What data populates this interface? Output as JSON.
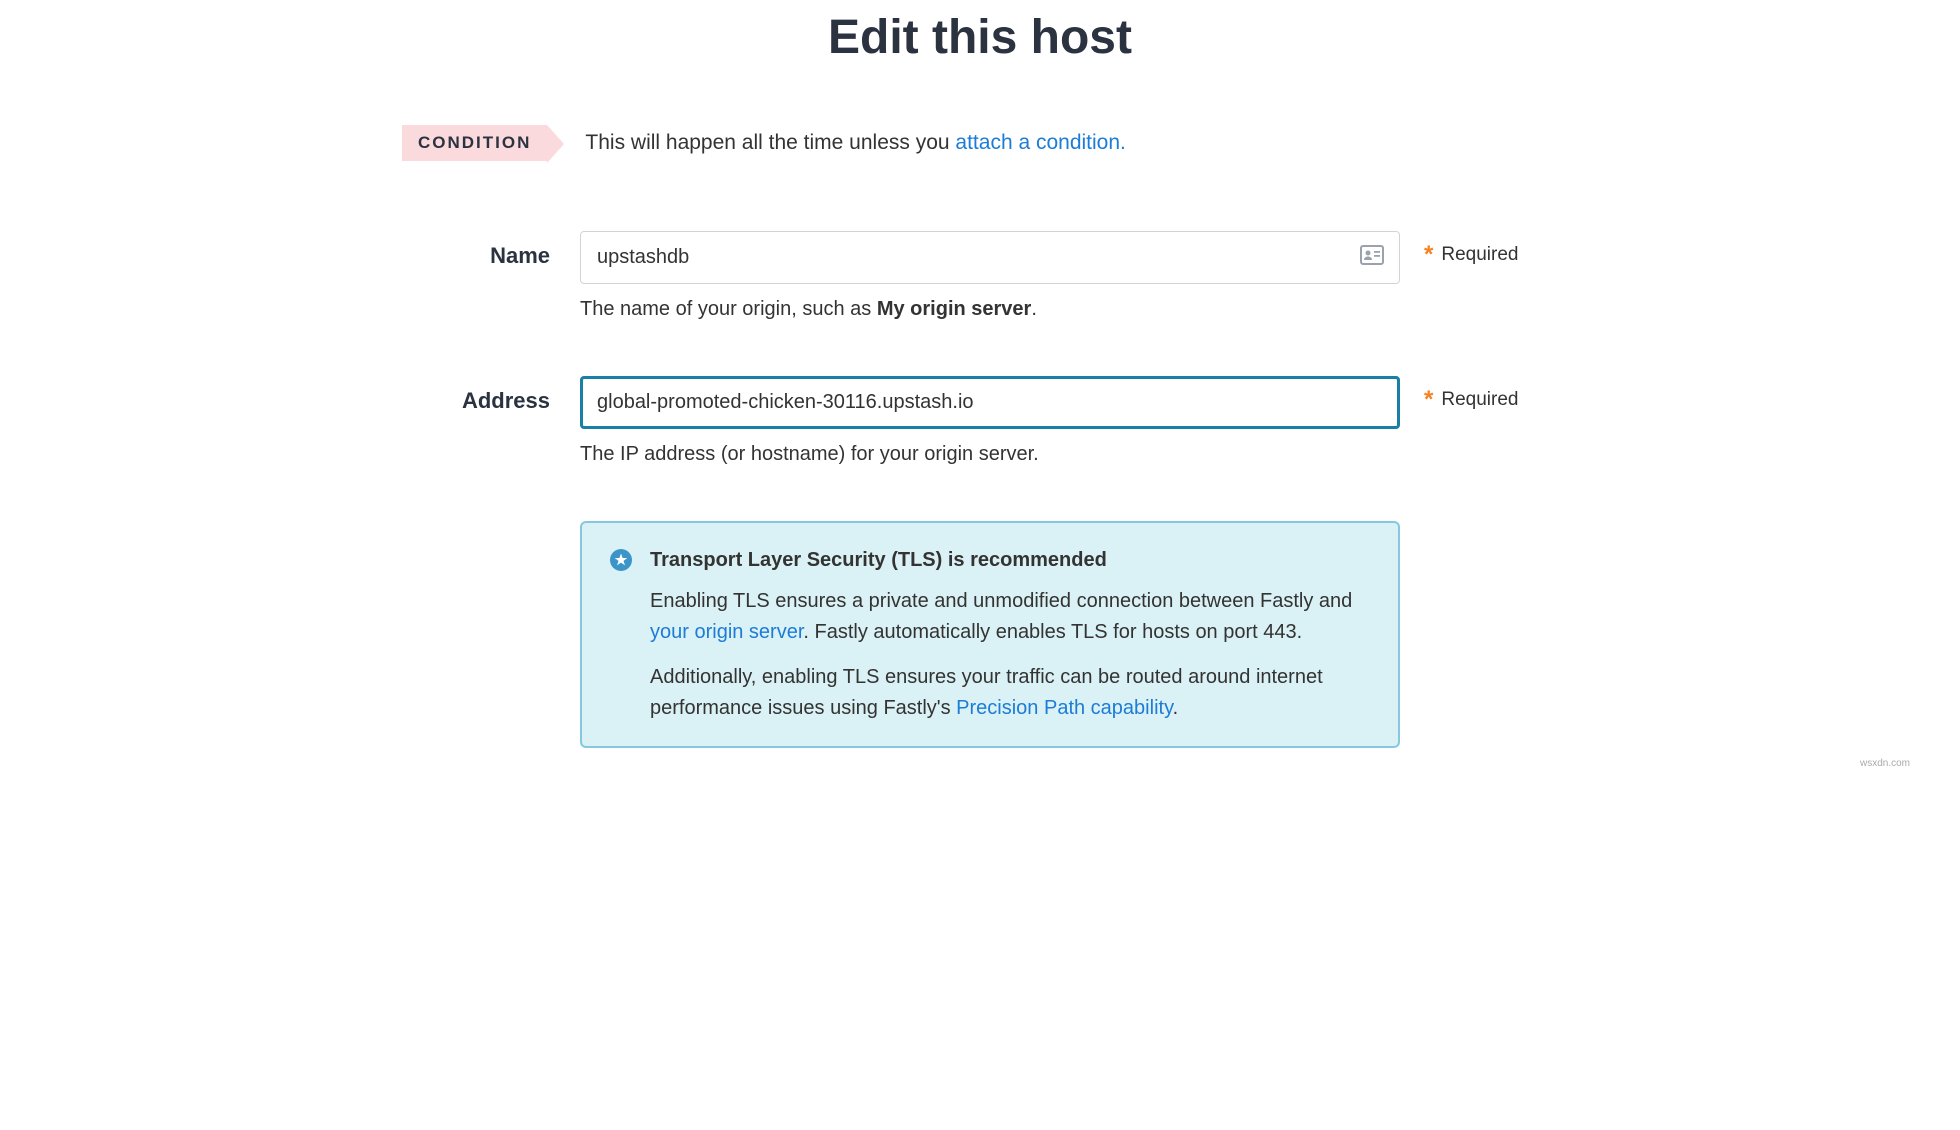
{
  "page": {
    "title": "Edit this host"
  },
  "condition": {
    "tag": "CONDITION",
    "text_prefix": "This will happen all the time unless you ",
    "link": "attach a condition.",
    "required_label": "Required"
  },
  "fields": {
    "name": {
      "label": "Name",
      "value": "upstashdb",
      "help_prefix": "The name of your origin, such as ",
      "help_bold": "My origin server",
      "help_suffix": "."
    },
    "address": {
      "label": "Address",
      "value": "global-promoted-chicken-30116.upstash.io",
      "help": "The IP address (or hostname) for your origin server."
    }
  },
  "tls_info": {
    "title": "Transport Layer Security (TLS) is recommended",
    "para1_a": "Enabling TLS ensures a private and unmodified connection between Fastly and ",
    "para1_link": "your origin server",
    "para1_b": ". Fastly automatically enables TLS for hosts on port 443.",
    "para2_a": "Additionally, enabling TLS ensures your traffic can be routed around internet performance issues using Fastly's ",
    "para2_link": "Precision Path capability",
    "para2_b": "."
  },
  "footer": {
    "mark": "wsxdn.com"
  }
}
